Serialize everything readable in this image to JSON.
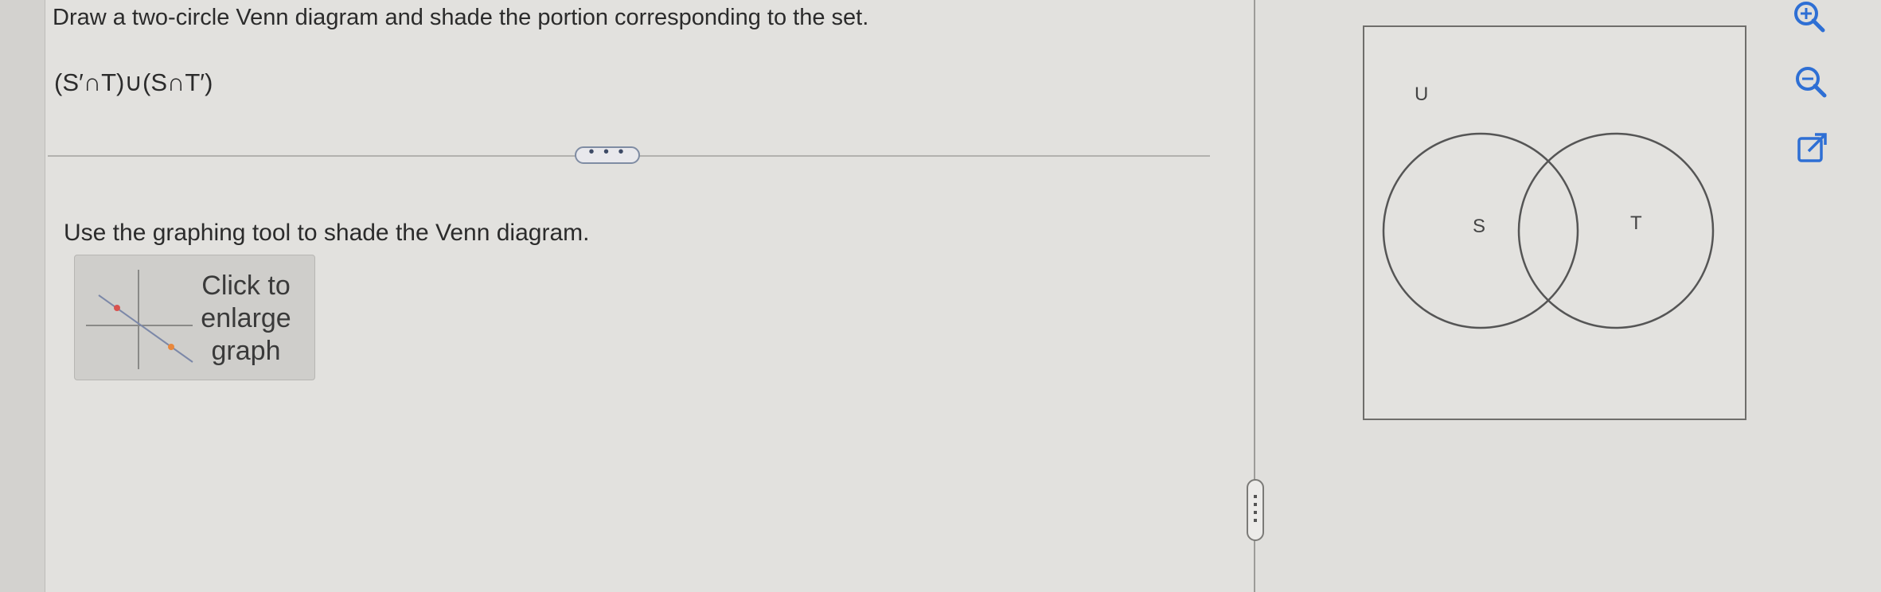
{
  "question": {
    "prompt": "Draw a two-circle Venn diagram and shade the portion corresponding to the set.",
    "expression": "(S′∩T)∪(S∩T′)",
    "more_button": "• • •",
    "instruction": "Use the graphing tool to shade the Venn diagram.",
    "graph_button": {
      "line1": "Click to",
      "line2": "enlarge",
      "line3": "graph"
    }
  },
  "venn": {
    "universe_label": "U",
    "set_a_label": "S",
    "set_b_label": "T"
  },
  "toolbar": {
    "zoom_in": "zoom-in",
    "zoom_out": "zoom-out",
    "popout": "open-in-new-window"
  },
  "colors": {
    "icon_accent": "#2e6fd4",
    "thumb_red": "#d9534f",
    "thumb_orange": "#e8873c"
  }
}
